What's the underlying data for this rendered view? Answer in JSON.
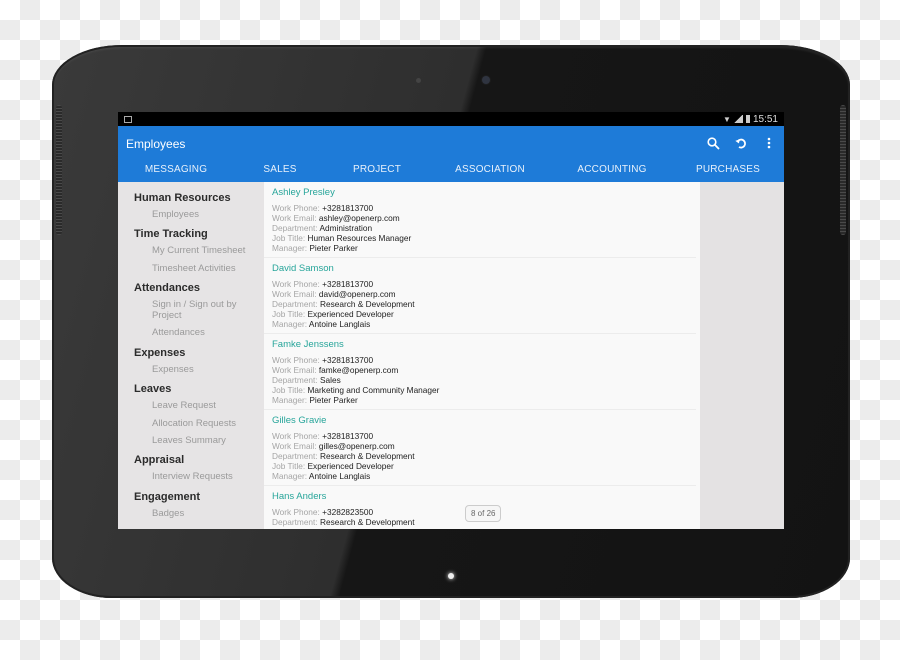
{
  "statusbar": {
    "time": "15:51"
  },
  "appbar": {
    "title": "Employees",
    "actions": [
      {
        "name": "search-icon"
      },
      {
        "name": "refresh-icon"
      },
      {
        "name": "overflow-menu-icon"
      }
    ],
    "tabs": [
      "MESSAGING",
      "SALES",
      "PROJECT",
      "ASSOCIATION",
      "ACCOUNTING",
      "PURCHASES"
    ]
  },
  "sidebar": {
    "sections": [
      {
        "title": "Human Resources",
        "items": [
          "Employees"
        ]
      },
      {
        "title": "Time Tracking",
        "items": [
          "My Current Timesheet",
          "Timesheet Activities"
        ]
      },
      {
        "title": "Attendances",
        "items": [
          "Sign in / Sign out by Project",
          "Attendances"
        ]
      },
      {
        "title": "Expenses",
        "items": [
          "Expenses"
        ]
      },
      {
        "title": "Leaves",
        "items": [
          "Leave Request",
          "Allocation Requests",
          "Leaves Summary"
        ]
      },
      {
        "title": "Appraisal",
        "items": [
          "Interview Requests"
        ]
      },
      {
        "title": "Engagement",
        "items": [
          "Badges"
        ]
      }
    ]
  },
  "labels": {
    "phone": "Work Phone: ",
    "email": "Work Email: ",
    "department": "Department: ",
    "job": "Job Title: ",
    "manager": "Manager: "
  },
  "employees": [
    {
      "name": "Ashley Presley",
      "phone": "+3281813700",
      "email": "ashley@openerp.com",
      "department": "Administration",
      "job": "Human Resources Manager",
      "manager": "Pieter Parker"
    },
    {
      "name": "David Samson",
      "phone": "+3281813700",
      "email": "david@openerp.com",
      "department": "Research & Development",
      "job": "Experienced Developer",
      "manager": "Antoine Langlais"
    },
    {
      "name": "Famke Jenssens",
      "phone": "+3281813700",
      "email": "famke@openerp.com",
      "department": "Sales",
      "job": "Marketing and Community Manager",
      "manager": "Pieter Parker"
    },
    {
      "name": "Gilles Gravie",
      "phone": "+3281813700",
      "email": "gilles@openerp.com",
      "department": "Research & Development",
      "job": "Experienced Developer",
      "manager": "Antoine Langlais"
    },
    {
      "name": "Hans Anders",
      "phone": "+3282823500",
      "department": "Research & Development"
    }
  ],
  "pager": "8 of 26",
  "colors": {
    "appbar": "#1e7bd8",
    "name_accent": "#27a59a"
  }
}
